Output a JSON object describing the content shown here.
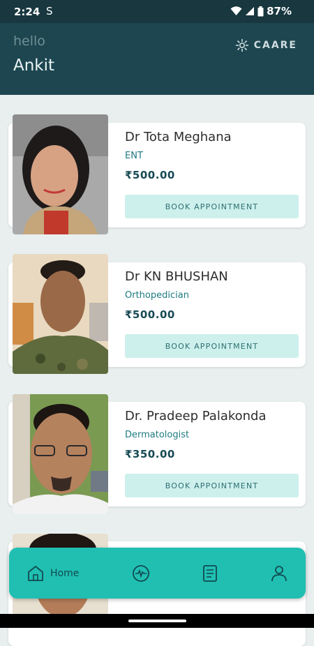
{
  "status_bar": {
    "time": "2:24",
    "battery": "87%"
  },
  "header": {
    "greeting": "hello",
    "user_name": "Ankit",
    "brand": "CAARE"
  },
  "doctors": [
    {
      "name": "Dr Tota Meghana",
      "specialty": "ENT",
      "fee": "₹500.00",
      "button": "BOOK APPOINTMENT"
    },
    {
      "name": "Dr KN BHUSHAN",
      "specialty": "Orthopedician",
      "fee": "₹500.00",
      "button": "BOOK APPOINTMENT"
    },
    {
      "name": "Dr. Pradeep Palakonda",
      "specialty": "Dermatologist",
      "fee": "₹350.00",
      "button": "BOOK APPOINTMENT"
    }
  ],
  "bottom_nav": {
    "home_label": "Home",
    "items": [
      "home-icon",
      "pulse-icon",
      "records-icon",
      "profile-icon"
    ]
  },
  "colors": {
    "header": "#1d4650",
    "nav": "#20bfb2",
    "button": "#cdf0ec",
    "fee": "#174a55"
  }
}
